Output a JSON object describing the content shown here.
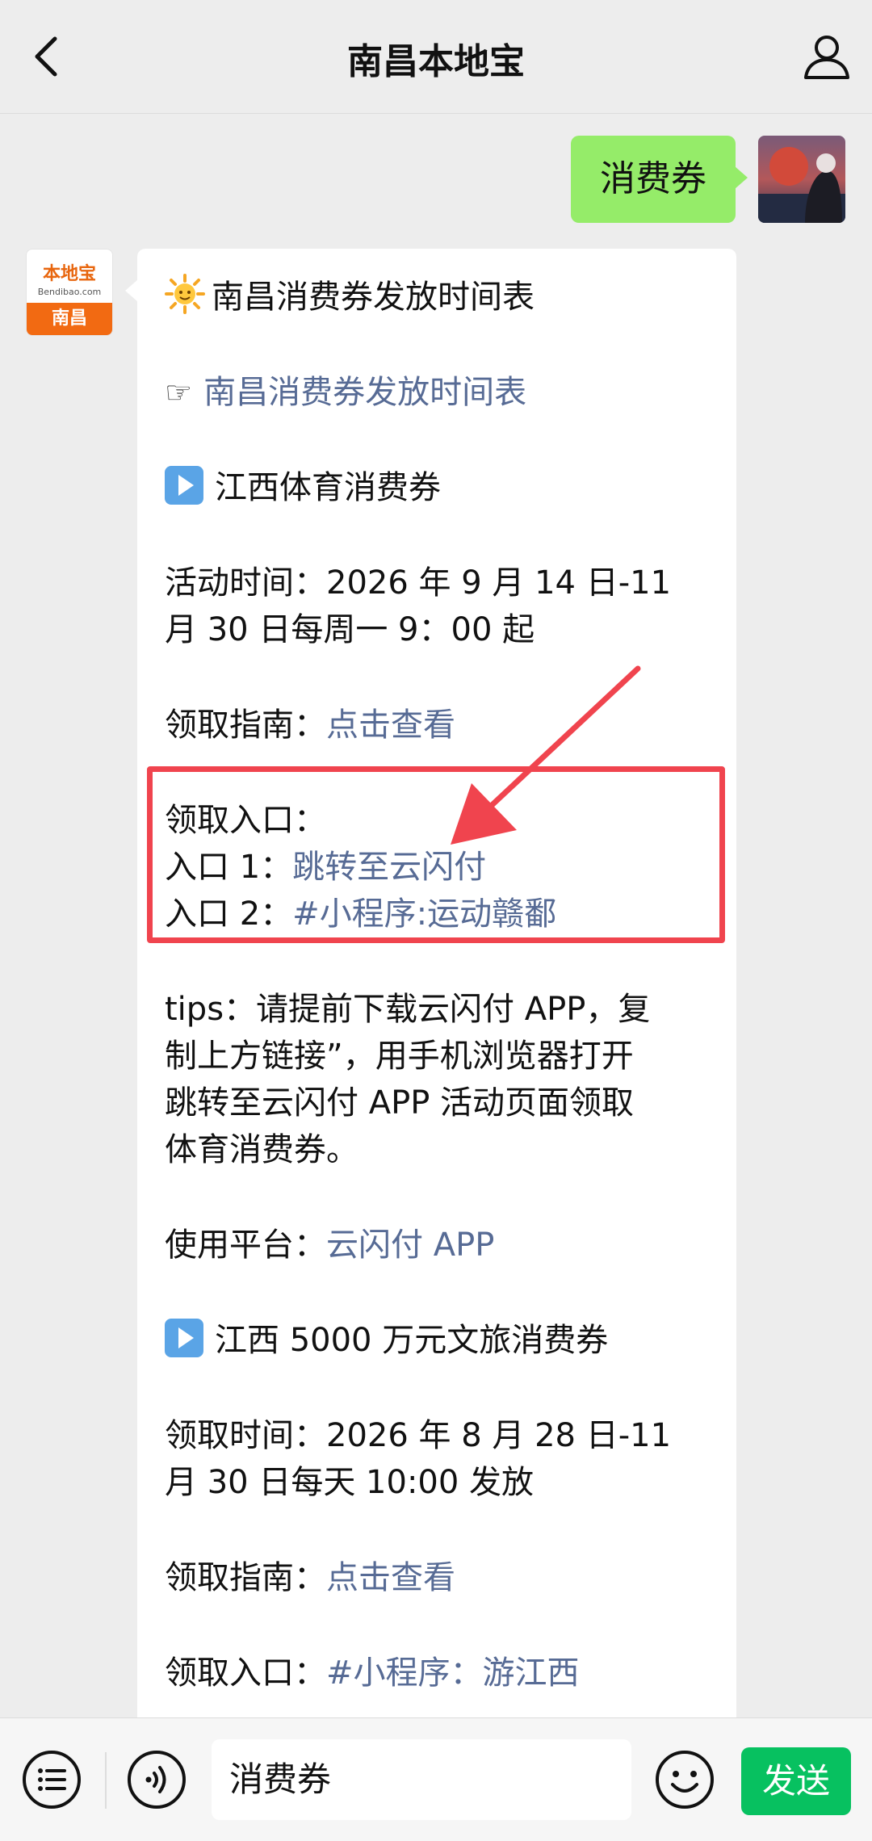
{
  "header": {
    "title": "南昌本地宝",
    "back_icon": "chevron-left-icon",
    "profile_icon": "user-icon"
  },
  "outgoing": {
    "text": "消费券"
  },
  "bot": {
    "avatar_brand": "本地宝",
    "avatar_site": "Bendibao.com",
    "avatar_city": "南昌"
  },
  "message": {
    "title": "南昌消费券发放时间表",
    "link_schedule": "南昌消费券发放时间表",
    "sport": {
      "heading": "江西体育消费券",
      "time_line1": "活动时间：2026 年 9 月 14 日-11",
      "time_line2": "月 30 日每周一 9：00 起",
      "guide_label": "领取指南：",
      "guide_link": "点击查看",
      "entry_label": "领取入口：",
      "entry1_label": "入口 1：",
      "entry1_link": "跳转至云闪付",
      "entry2_label": "入口 2：",
      "entry2_link": "#小程序:运动赣鄱",
      "tips_line1": "tips：请提前下载云闪付 APP，复",
      "tips_line2": "制上方链接”，用手机浏览器打开",
      "tips_line3": "跳转至云闪付 APP 活动页面领取",
      "tips_line4": "体育消费券。",
      "platform_label": "使用平台：",
      "platform_link": "云闪付 APP"
    },
    "travel": {
      "heading": "江西 5000 万元文旅消费券",
      "time_line1": "领取时间：2026 年 8 月 28 日-11",
      "time_line2": "月 30 日每天 10:00 发放",
      "guide_label": "领取指南：",
      "guide_link": "点击查看",
      "entry_label": "领取入口：",
      "entry_link": "#小程序：游江西"
    }
  },
  "composer": {
    "input_value": "消费券",
    "send_label": "发送",
    "menu_icon": "list-icon",
    "voice_icon": "voice-icon",
    "emoji_icon": "emoji-icon"
  },
  "colors": {
    "bubble_out": "#95ec69",
    "link": "#576b95",
    "send": "#07c160",
    "highlight": "#f0444e"
  }
}
